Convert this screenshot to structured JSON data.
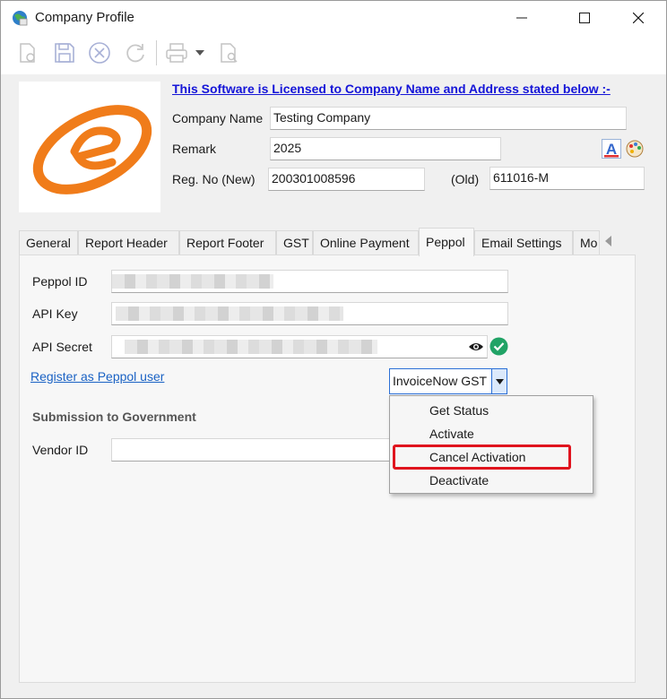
{
  "window": {
    "title": "Company Profile"
  },
  "toolbar": {
    "icons": [
      "new-doc-icon",
      "save-icon",
      "cancel-icon",
      "refresh-icon",
      "print-icon",
      "dropdown-arrow-icon",
      "preview-icon"
    ]
  },
  "header": {
    "license_text": "This Software is Licensed to Company Name and Address stated below :-",
    "company_name_label": "Company Name",
    "company_name_value": "Testing Company",
    "remark_label": "Remark",
    "remark_value": "2025",
    "reg_new_label": "Reg. No (New)",
    "reg_new_value": "200301008596",
    "reg_old_label": "(Old)",
    "reg_old_value": "611016-M"
  },
  "tabs": [
    {
      "label": "General"
    },
    {
      "label": "Report Header"
    },
    {
      "label": "Report Footer"
    },
    {
      "label": "GST"
    },
    {
      "label": "Online Payment"
    },
    {
      "label": "Peppol",
      "active": true
    },
    {
      "label": "Email Settings"
    },
    {
      "label": "Mo"
    }
  ],
  "peppol": {
    "id_label": "Peppol ID",
    "api_key_label": "API Key",
    "api_secret_label": "API Secret",
    "register_link": "Register as Peppol user",
    "combo_value": "InvoiceNow GST",
    "submission_header": "Submission to Government",
    "vendor_label": "Vendor ID"
  },
  "dropdown": {
    "items": [
      "Get Status",
      "Activate",
      "Cancel Activation",
      "Deactivate"
    ],
    "highlighted": "Cancel Activation"
  },
  "colors": {
    "link": "#1515d8",
    "highlight_border": "#e0141e",
    "check_green": "#21a366",
    "logo_orange": "#f07c1a"
  }
}
